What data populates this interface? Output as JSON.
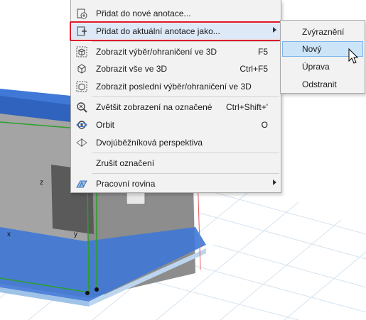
{
  "menu": {
    "items": [
      {
        "label": "Přidat do nové anotace...",
        "shortcut": "",
        "icon": "add-annotation-icon"
      },
      {
        "label": "Přidat do aktuální anotace jako...",
        "shortcut": "",
        "icon": "add-to-current-annotation-icon",
        "submenu": true
      },
      {
        "label": "Zobrazit výběr/ohraničení ve 3D",
        "shortcut": "F5",
        "icon": "show-selection-3d-icon"
      },
      {
        "label": "Zobrazit vše ve 3D",
        "shortcut": "Ctrl+F5",
        "icon": "show-all-3d-icon"
      },
      {
        "label": "Zobrazit poslední výběr/ohraničení ve 3D",
        "shortcut": "",
        "icon": "show-last-selection-3d-icon"
      },
      {
        "label": "Zvětšit zobrazení na označené",
        "shortcut": "Ctrl+Shift+'",
        "icon": "zoom-to-selection-icon"
      },
      {
        "label": "Orbit",
        "shortcut": "O",
        "icon": "orbit-icon"
      },
      {
        "label": "Dvojúběžníková perspektiva",
        "shortcut": "",
        "icon": "two-point-perspective-icon"
      },
      {
        "label": "Zrušit označení",
        "shortcut": "",
        "icon": ""
      },
      {
        "label": "Pracovní rovina",
        "shortcut": "",
        "icon": "work-plane-icon",
        "submenu": true
      }
    ]
  },
  "submenu": {
    "items": [
      "Zvýraznění",
      "Nový",
      "Úprava",
      "Odstranit"
    ]
  },
  "viewport": {
    "axis_x": "x",
    "axis_y": "y",
    "axis_z": "z"
  },
  "colors": {
    "highlight_border": "#e01a2b",
    "hover_fill": "#cce4f7",
    "slab_blue": "#3f78d6",
    "edge_green": "#2aa02a"
  }
}
